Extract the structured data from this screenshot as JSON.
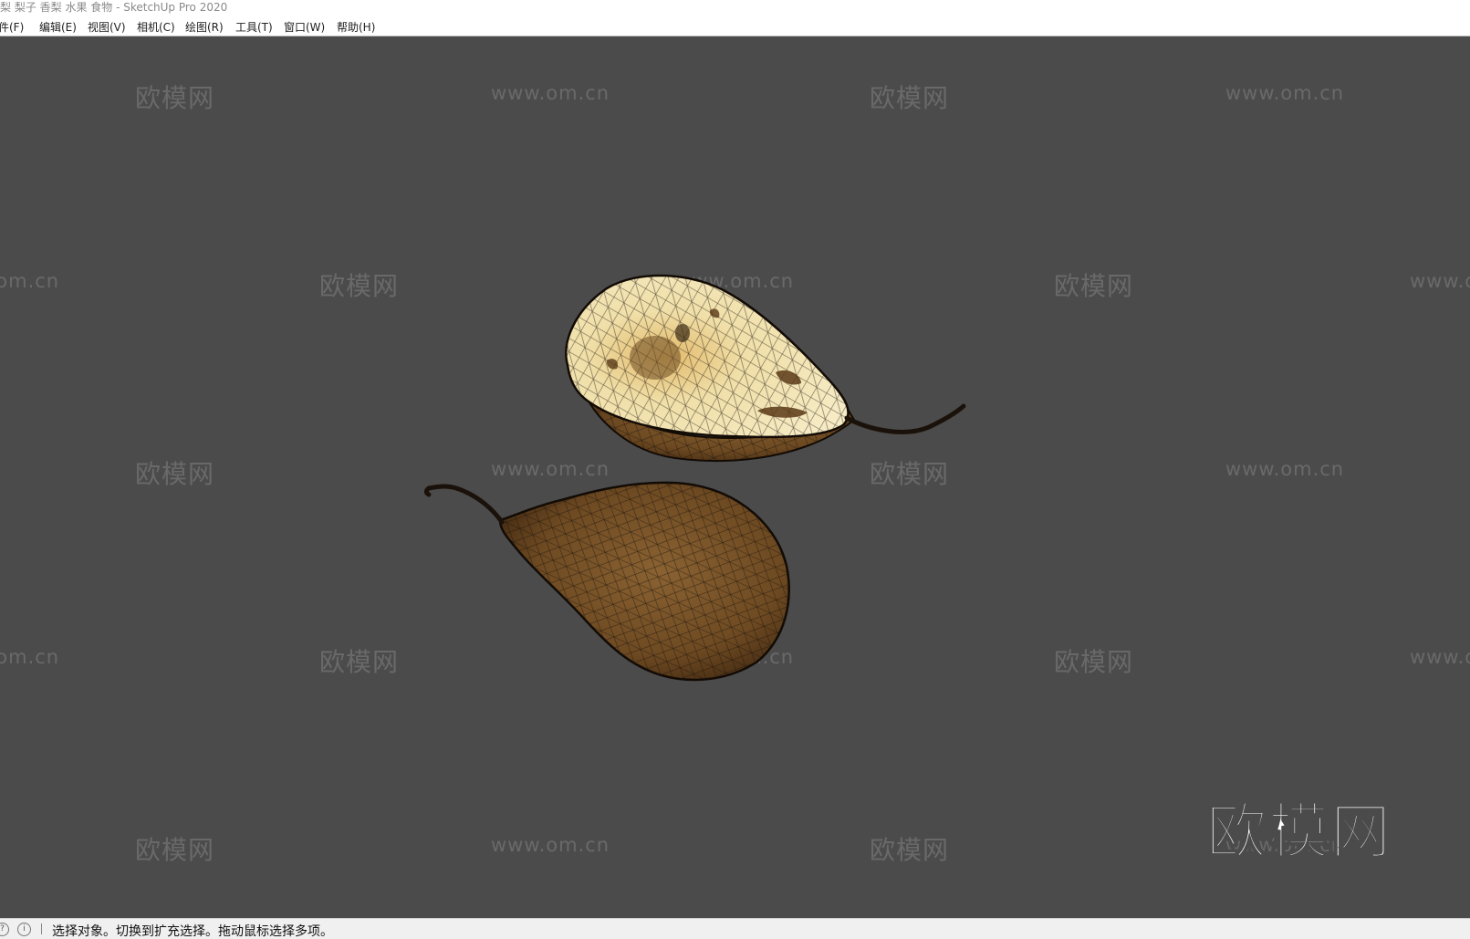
{
  "window": {
    "title": "梨 梨子 香梨 水果 食物 - SketchUp Pro 2020"
  },
  "menu": {
    "items": [
      {
        "label": "文件(F)"
      },
      {
        "label": "编辑(E)"
      },
      {
        "label": "视图(V)"
      },
      {
        "label": "相机(C)"
      },
      {
        "label": "绘图(R)"
      },
      {
        "label": "工具(T)"
      },
      {
        "label": "窗口(W)"
      },
      {
        "label": "帮助(H)"
      }
    ]
  },
  "viewport": {
    "background": "#4b4b4b",
    "model": "two pears, one sliced in half, wireframe textured",
    "watermarks": {
      "brand": "欧模网",
      "url": "www.om.cn"
    },
    "logo": "欧模网"
  },
  "status": {
    "text": "选择对象。切换到扩充选择。拖动鼠标选择多项。",
    "icons": [
      "question-icon",
      "info-icon"
    ]
  },
  "colors": {
    "pear_skin": "#6e4a22",
    "pear_flesh": "#f0dfa8",
    "wire": "#1a120a"
  }
}
